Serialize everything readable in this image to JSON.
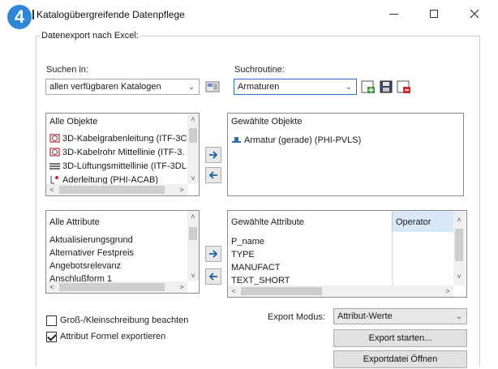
{
  "window": {
    "step_number": "4",
    "title": "Katalogübergreifende Datenpflege"
  },
  "export_group": {
    "label": "Datenexport nach Excel:"
  },
  "search_in": {
    "label": "Suchen in:",
    "selected": "allen verfügbaren Katalogen"
  },
  "search_routine": {
    "label": "Suchroutine:",
    "selected": "Armaturen"
  },
  "all_objects": {
    "header": "Alle Objekte",
    "items": [
      "3D-Kabelgrabenleitung (ITF-3C",
      "3D-Kabelrohr Mittellinie (ITF-3.",
      "3D-Lüftungsmittellinie (ITF-3DL",
      "Aderleitung (PHI-ACAB)"
    ]
  },
  "selected_objects": {
    "header": "Gewählte Objekte",
    "items": [
      "Armatur (gerade) (PHI-PVLS)"
    ]
  },
  "all_attributes": {
    "header": "Alle Attribute",
    "items": [
      "Aktualisierungsgrund",
      "Alternativer Festpreis",
      "Angebotsrelevanz",
      "Anschlußform 1"
    ]
  },
  "selected_attributes": {
    "col_attribute": "Gewählte Attribute",
    "col_operator": "Operator",
    "items": [
      "P_name",
      "TYPE",
      "MANUFACT",
      "TEXT_SHORT"
    ]
  },
  "options": {
    "case_sensitive_label": "Groß-/Kleinschreibung beachten",
    "case_sensitive_checked": false,
    "export_formula_label": "Attribut Formel exportieren",
    "export_formula_checked": true
  },
  "export_mode": {
    "label": "Export Modus:",
    "selected": "Attribut-Werte"
  },
  "buttons": {
    "start_export": "Export starten...",
    "open_export_file": "Exportdatei Öffnen"
  },
  "colors": {
    "accent_blue": "#2f86d6",
    "operator_header_bg": "#d9e8f7"
  }
}
